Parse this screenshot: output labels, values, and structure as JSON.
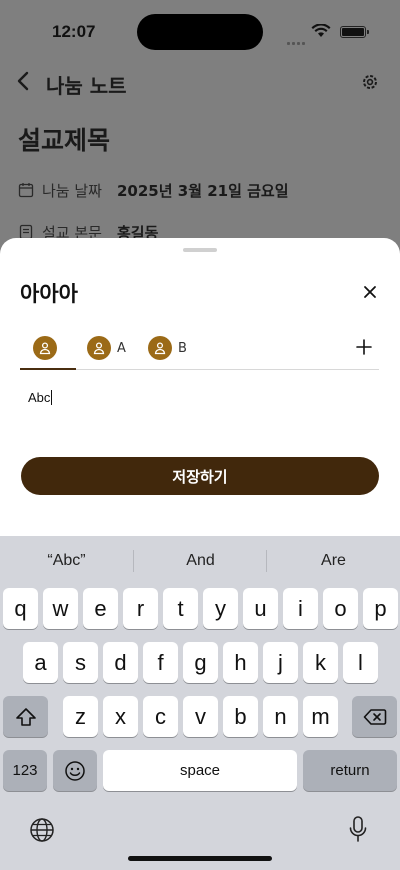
{
  "status_bar": {
    "time": "12:07"
  },
  "nav": {
    "title": "나눔 노트"
  },
  "page": {
    "title": "설교제목",
    "date_label": "나눔 날짜",
    "date_value": "2025년 3월 21일 금요일",
    "text_label": "설교 본문",
    "text_value": "홍길동"
  },
  "sheet": {
    "title": "아아아",
    "tabs": [
      {
        "label": ""
      },
      {
        "label": "A"
      },
      {
        "label": "B"
      }
    ],
    "editor_text": "Abc",
    "save_label": "저장하기"
  },
  "keyboard": {
    "suggestions": [
      "“Abc”",
      "And",
      "Are"
    ],
    "row1": [
      "q",
      "w",
      "e",
      "r",
      "t",
      "y",
      "u",
      "i",
      "o",
      "p"
    ],
    "row2": [
      "a",
      "s",
      "d",
      "f",
      "g",
      "h",
      "j",
      "k",
      "l"
    ],
    "row3": [
      "z",
      "x",
      "c",
      "v",
      "b",
      "n",
      "m"
    ],
    "numbers_label": "123",
    "space_label": "space",
    "return_label": "return"
  },
  "colors": {
    "accent": "#41280c",
    "avatar": "#9b6a17",
    "keyboard_bg": "#d3d5db"
  }
}
